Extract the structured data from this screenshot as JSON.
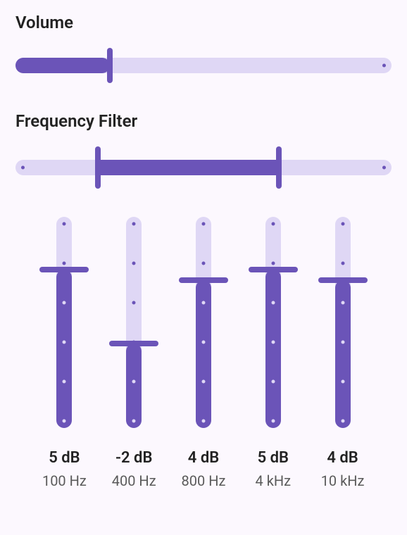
{
  "colors": {
    "accent": "#6b54b8",
    "track": "#dfd7f5",
    "bg": "#fcf8fe"
  },
  "volume": {
    "title": "Volume",
    "percent": 25
  },
  "frequency": {
    "title": "Frequency Filter",
    "low_percent": 22,
    "high_percent": 70
  },
  "eq": {
    "min_db": -10,
    "max_db": 10,
    "bands": [
      {
        "db": 5,
        "db_label": "5 dB",
        "freq_label": "100 Hz"
      },
      {
        "db": -2,
        "db_label": "-2 dB",
        "freq_label": "400 Hz"
      },
      {
        "db": 4,
        "db_label": "4 dB",
        "freq_label": "800 Hz"
      },
      {
        "db": 5,
        "db_label": "5 dB",
        "freq_label": "4 kHz"
      },
      {
        "db": 4,
        "db_label": "4 dB",
        "freq_label": "10 kHz"
      }
    ]
  }
}
